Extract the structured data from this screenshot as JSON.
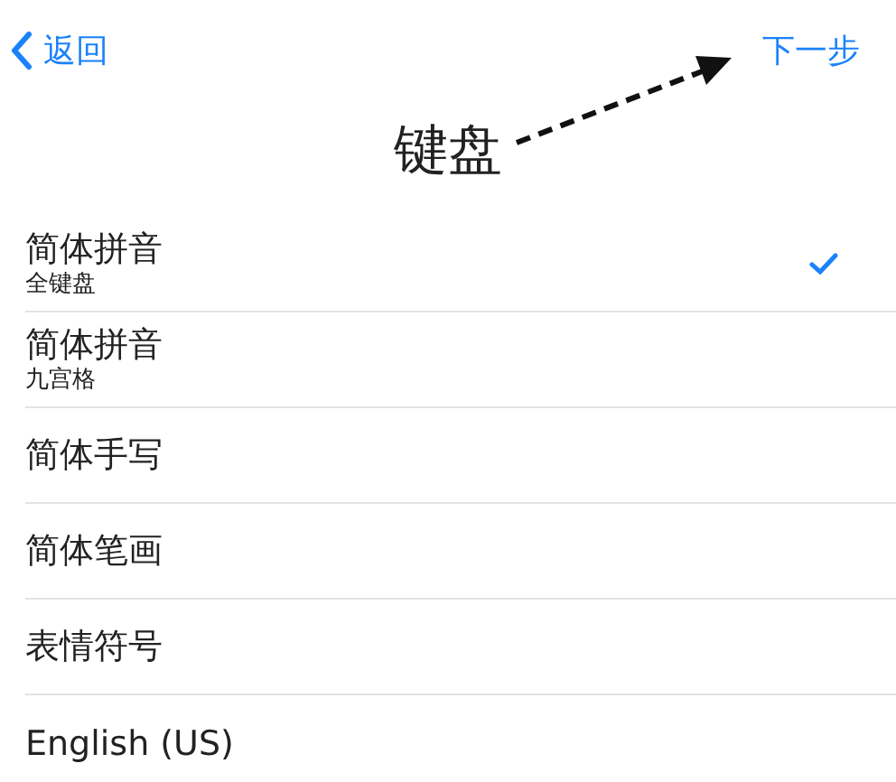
{
  "nav": {
    "back": "返回",
    "next": "下一步"
  },
  "title": "键盘",
  "keyboards": [
    {
      "name": "简体拼音",
      "subtitle": "全键盘",
      "selected": true
    },
    {
      "name": "简体拼音",
      "subtitle": "九宫格",
      "selected": false
    },
    {
      "name": "简体手写",
      "selected": false
    },
    {
      "name": "简体笔画",
      "selected": false
    },
    {
      "name": "表情符号",
      "selected": false
    },
    {
      "name": "English (US)",
      "selected": false
    }
  ]
}
